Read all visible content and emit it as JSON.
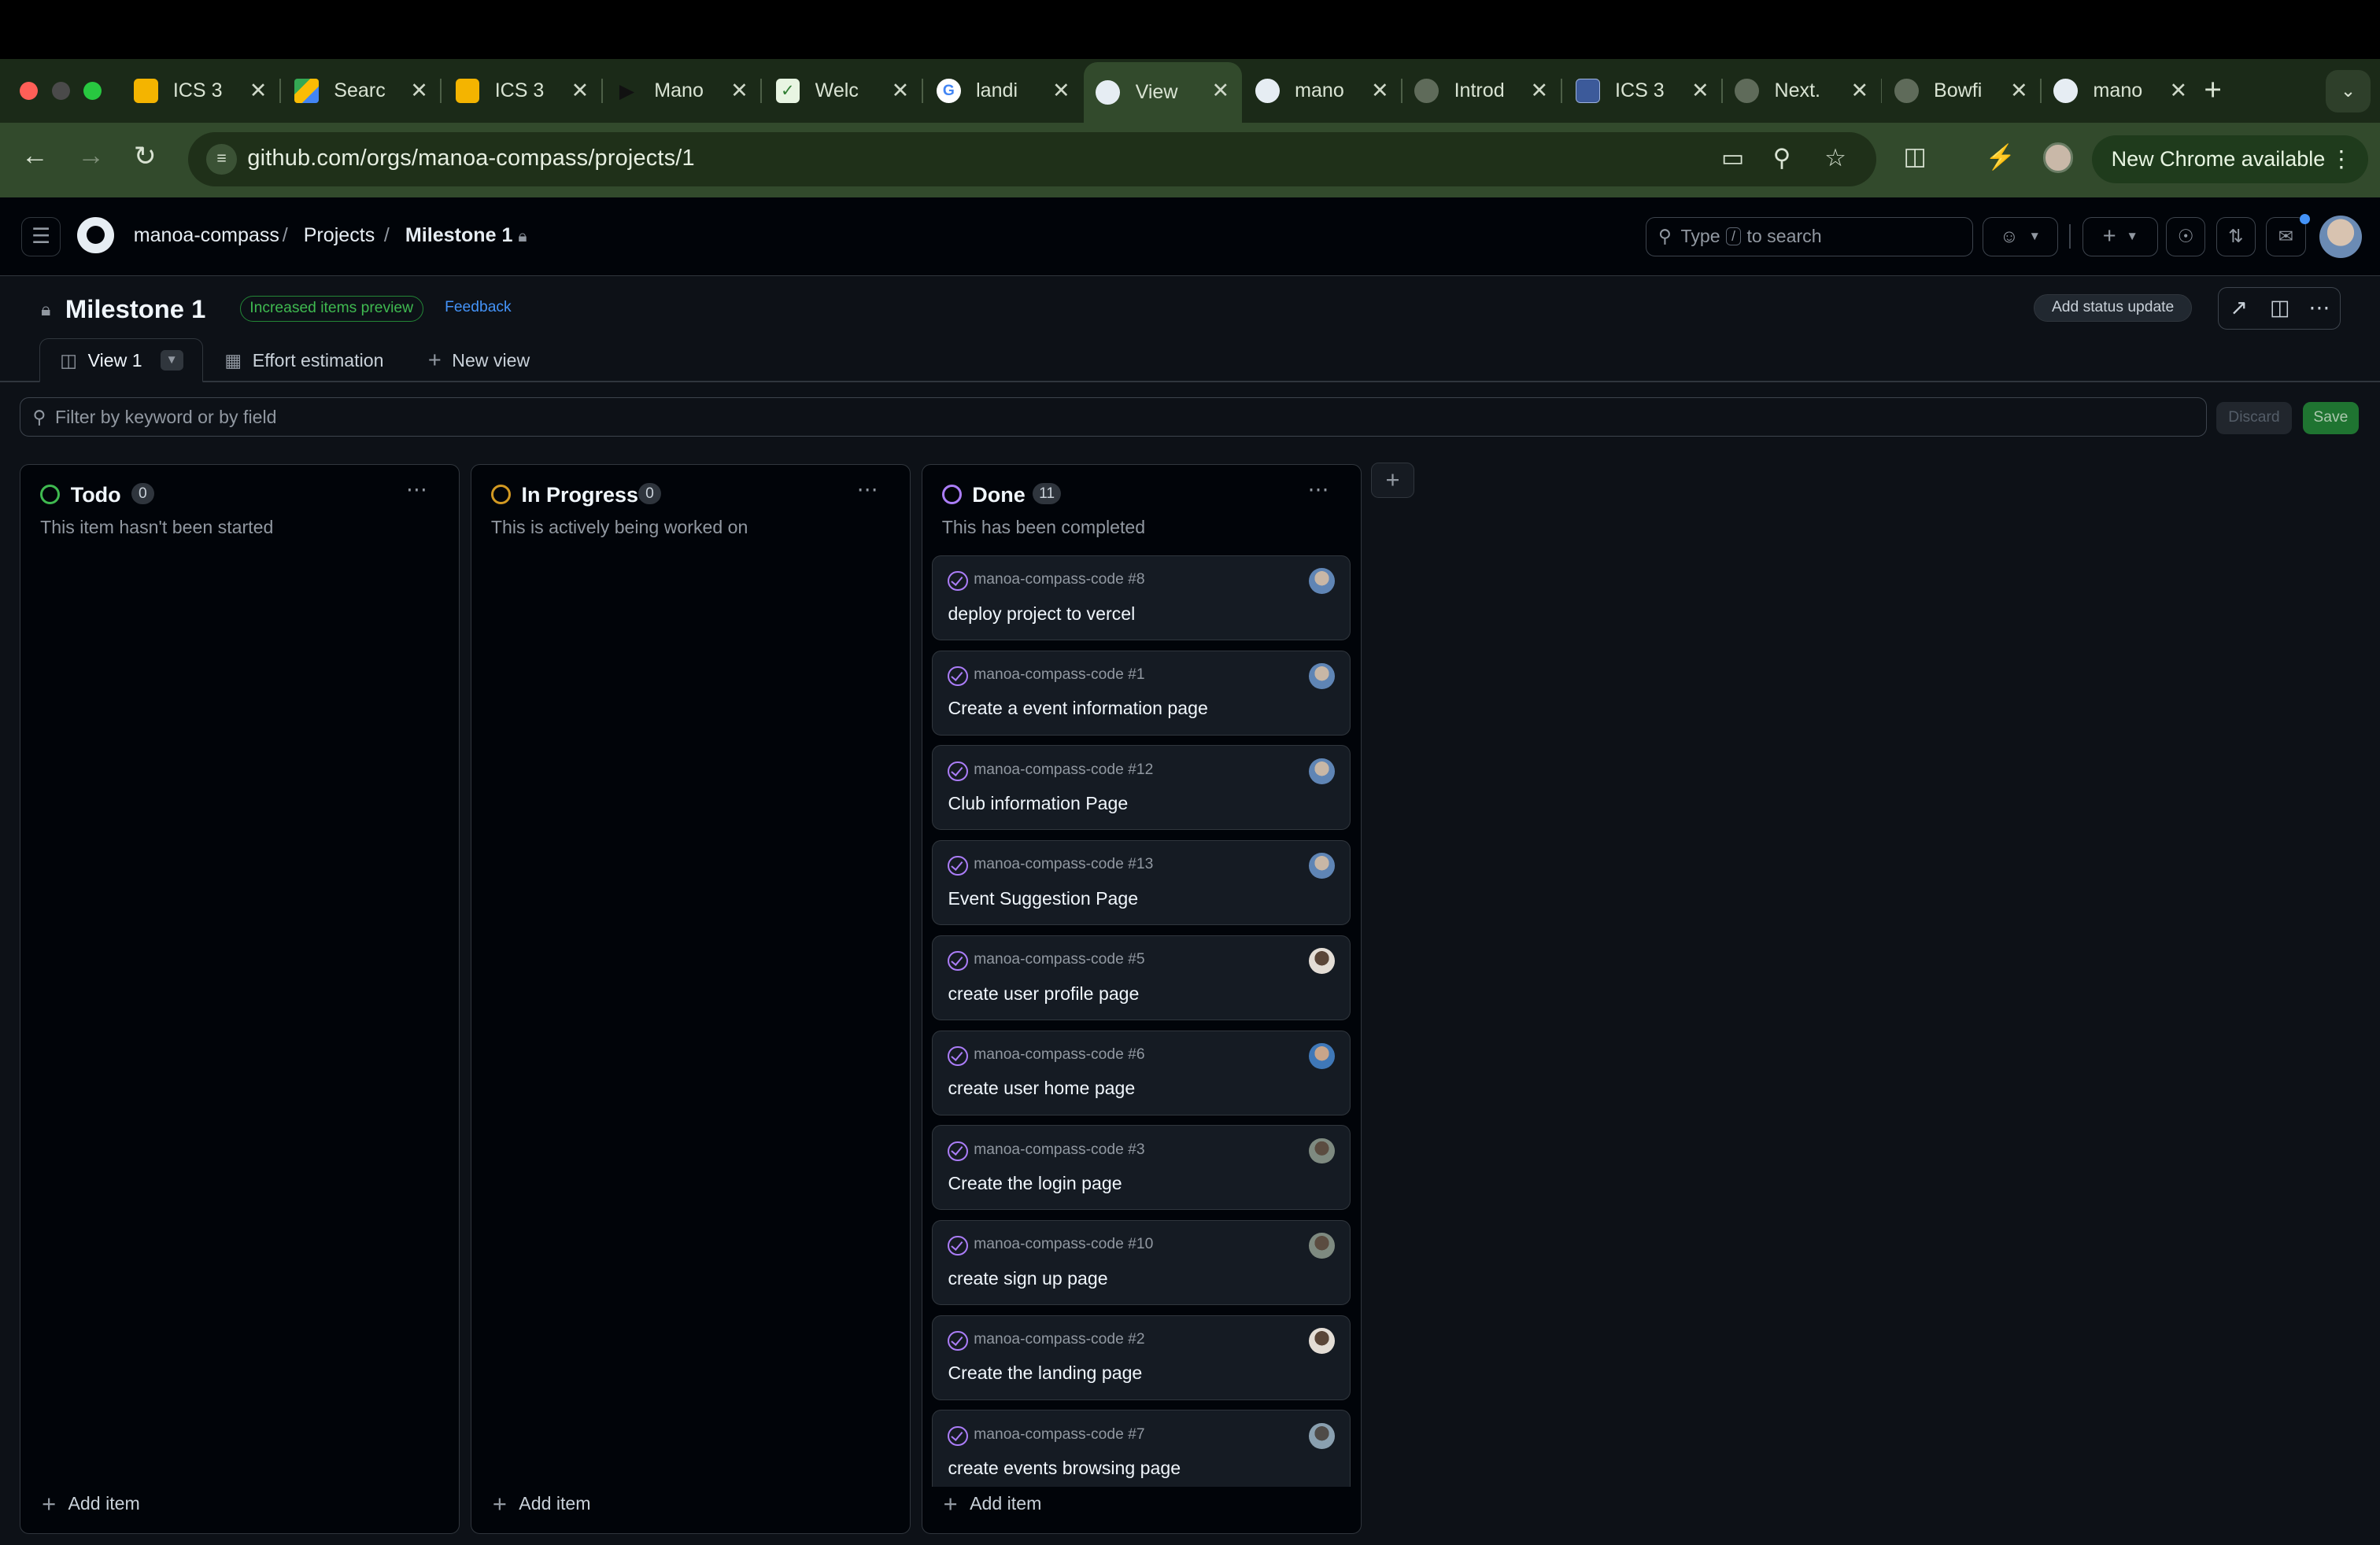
{
  "browser": {
    "tabs": [
      {
        "label": "ICS 3",
        "favicon": "slides-icon"
      },
      {
        "label": "Searc",
        "favicon": "drive-icon"
      },
      {
        "label": "ICS 3",
        "favicon": "slides-icon"
      },
      {
        "label": "Mano",
        "favicon": "play-icon"
      },
      {
        "label": "Welc",
        "favicon": "leaf-icon"
      },
      {
        "label": "landi",
        "favicon": "google-icon"
      },
      {
        "label": "View",
        "favicon": "github-icon",
        "active": true
      },
      {
        "label": "mano",
        "favicon": "github-icon"
      },
      {
        "label": "Introd",
        "favicon": "globe-icon"
      },
      {
        "label": "ICS 3",
        "favicon": "doc-icon"
      },
      {
        "label": "Next.",
        "favicon": "globe-icon"
      },
      {
        "label": "Bowfi",
        "favicon": "globe-icon"
      },
      {
        "label": "mano",
        "favicon": "github-icon"
      }
    ],
    "url": "github.com/orgs/manoa-compass/projects/1",
    "update_label": "New Chrome available"
  },
  "github": {
    "breadcrumb": {
      "org": "manoa-compass",
      "projects": "Projects",
      "current": "Milestone 1"
    },
    "search": {
      "before": "Type",
      "key": "/",
      "after": "to search"
    }
  },
  "project": {
    "title": "Milestone 1",
    "preview_badge": "Increased items preview",
    "feedback": "Feedback",
    "status_button": "Add status update",
    "views": {
      "view1": "View 1",
      "effort": "Effort estimation",
      "new_view": "New view"
    },
    "filter_placeholder": "Filter by keyword or by field",
    "discard": "Discard",
    "save": "Save"
  },
  "columns": [
    {
      "name": "Todo",
      "count": "0",
      "description": "This item hasn't been started",
      "color": "#3fb950",
      "add_label": "Add item"
    },
    {
      "name": "In Progress",
      "count": "0",
      "description": "This is actively being worked on",
      "color": "#d29922",
      "add_label": "Add item"
    },
    {
      "name": "Done",
      "count": "11",
      "description": "This has been completed",
      "color": "#ab7df8",
      "add_label": "Add item"
    }
  ],
  "done_items": [
    {
      "repo": "manoa-compass-code #8",
      "title": "deploy project to vercel"
    },
    {
      "repo": "manoa-compass-code #1",
      "title": "Create a event information page"
    },
    {
      "repo": "manoa-compass-code #12",
      "title": "Club information Page"
    },
    {
      "repo": "manoa-compass-code #13",
      "title": "Event Suggestion Page"
    },
    {
      "repo": "manoa-compass-code #5",
      "title": "create user profile page"
    },
    {
      "repo": "manoa-compass-code #6",
      "title": "create user home page"
    },
    {
      "repo": "manoa-compass-code #3",
      "title": "Create the login page"
    },
    {
      "repo": "manoa-compass-code #10",
      "title": "create sign up page"
    },
    {
      "repo": "manoa-compass-code #2",
      "title": "Create the landing page"
    },
    {
      "repo": "manoa-compass-code #7",
      "title": "create events browsing page"
    }
  ]
}
